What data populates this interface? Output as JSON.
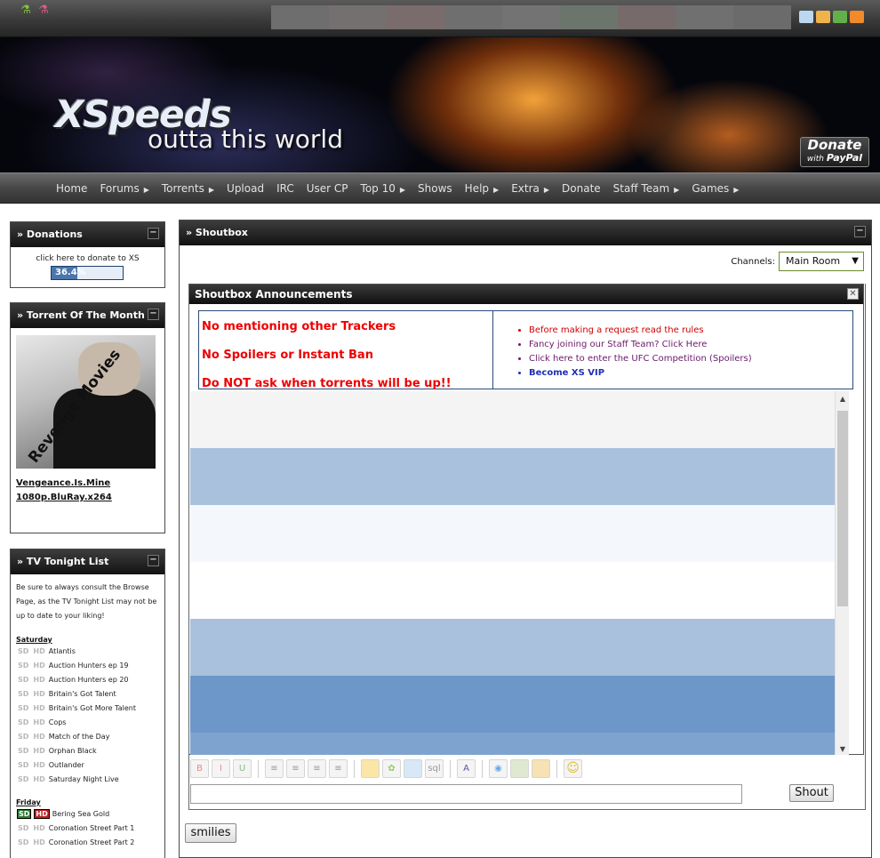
{
  "banner": {
    "logo": "XSpeeds",
    "tagline": "outta this world",
    "donate_top": "Donate",
    "donate_with": "with",
    "donate_paypal": "PayPal"
  },
  "nav": {
    "items": [
      {
        "label": "Home",
        "arrow": false
      },
      {
        "label": "Forums",
        "arrow": true
      },
      {
        "label": "Torrents",
        "arrow": true
      },
      {
        "label": "Upload",
        "arrow": false
      },
      {
        "label": "IRC",
        "arrow": false
      },
      {
        "label": "User CP",
        "arrow": false
      },
      {
        "label": "Top 10",
        "arrow": true
      },
      {
        "label": "Shows",
        "arrow": false
      },
      {
        "label": "Help",
        "arrow": true
      },
      {
        "label": "Extra",
        "arrow": true
      },
      {
        "label": "Donate",
        "arrow": false
      },
      {
        "label": "Staff Team",
        "arrow": true
      },
      {
        "label": "Games",
        "arrow": true
      }
    ]
  },
  "donations": {
    "title": "» Donations",
    "text": "click here to donate to XS",
    "percent_label": "36.4%",
    "percent": 36.4
  },
  "totm": {
    "title": "» Torrent Of The Month",
    "poster_text": "Revenge Movies",
    "link_line1": "Vengeance.Is.Mine",
    "link_line2": "1080p.BluRay.x264"
  },
  "tv": {
    "title": "» TV Tonight List",
    "intro": "Be sure to always consult the Browse Page, as the TV Tonight List may not be up to date to your liking!",
    "sd": "SD",
    "hd": "HD",
    "days": [
      {
        "day": "Saturday",
        "shows": [
          {
            "name": "Atlantis",
            "sd": false,
            "hd": false
          },
          {
            "name": "Auction Hunters ep 19",
            "sd": false,
            "hd": false
          },
          {
            "name": "Auction Hunters ep 20",
            "sd": false,
            "hd": false
          },
          {
            "name": "Britain's Got Talent",
            "sd": false,
            "hd": false
          },
          {
            "name": "Britain's Got More Talent",
            "sd": false,
            "hd": false
          },
          {
            "name": "Cops",
            "sd": false,
            "hd": false
          },
          {
            "name": "Match of the Day",
            "sd": false,
            "hd": false
          },
          {
            "name": "Orphan Black",
            "sd": false,
            "hd": false
          },
          {
            "name": "Outlander",
            "sd": false,
            "hd": false
          },
          {
            "name": "Saturday Night Live",
            "sd": false,
            "hd": false
          }
        ]
      },
      {
        "day": "Friday",
        "shows": [
          {
            "name": "Bering Sea Gold",
            "sd": true,
            "hd": true
          },
          {
            "name": "Coronation Street Part 1",
            "sd": false,
            "hd": false
          },
          {
            "name": "Coronation Street Part 2",
            "sd": false,
            "hd": false
          }
        ]
      }
    ]
  },
  "shoutbox": {
    "title": "» Shoutbox",
    "channels_label": "Channels:",
    "channel_selected": "Main Room",
    "announcements_title": "Shoutbox Announcements",
    "rules": [
      "No mentioning other Trackers",
      "No Spoilers or Instant Ban",
      "Do NOT ask when torrents will be up!!"
    ],
    "links": [
      {
        "text": "Before making a request read the rules",
        "style": "red"
      },
      {
        "text": "Fancy joining our Staff Team? Click Here",
        "style": "purple"
      },
      {
        "text": "Click here to enter the UFC Competition (Spoilers)",
        "style": "purple"
      },
      {
        "text": "Become XS VIP",
        "style": "blue"
      }
    ],
    "messages": [
      {
        "bg": "#f4f4f4"
      },
      {
        "bg": "#a9c1dc"
      },
      {
        "bg": "#f4f8fc"
      },
      {
        "bg": "#ffffff"
      },
      {
        "bg": "#a9c1dc"
      },
      {
        "bg": "#6d97c8"
      },
      {
        "bg": "#7ea3cf"
      }
    ],
    "shout_button": "Shout",
    "smilies_button": "smilies"
  }
}
